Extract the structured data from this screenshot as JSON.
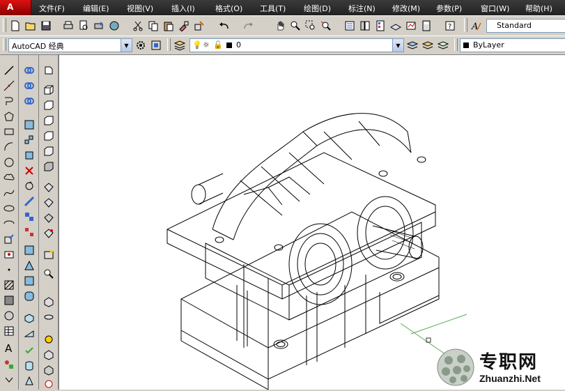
{
  "menu": {
    "items": [
      {
        "label": "文件(F)"
      },
      {
        "label": "编辑(E)"
      },
      {
        "label": "视图(V)"
      },
      {
        "label": "插入(I)"
      },
      {
        "label": "格式(O)"
      },
      {
        "label": "工具(T)"
      },
      {
        "label": "绘图(D)"
      },
      {
        "label": "标注(N)"
      },
      {
        "label": "修改(M)"
      },
      {
        "label": "参数(P)"
      },
      {
        "label": "窗口(W)"
      },
      {
        "label": "帮助(H)"
      }
    ]
  },
  "toolbar": {
    "text_style": "Standard",
    "workspace": "AutoCAD 经典",
    "layer": "0",
    "color": "ByLayer"
  },
  "watermark": {
    "title": "专职网",
    "url": "Zhuanzhi.Net"
  },
  "colors": {
    "menubar": "#2b2b2b",
    "chrome": "#d4d0c8",
    "canvas": "#ffffff",
    "logo": "#cc1111"
  }
}
